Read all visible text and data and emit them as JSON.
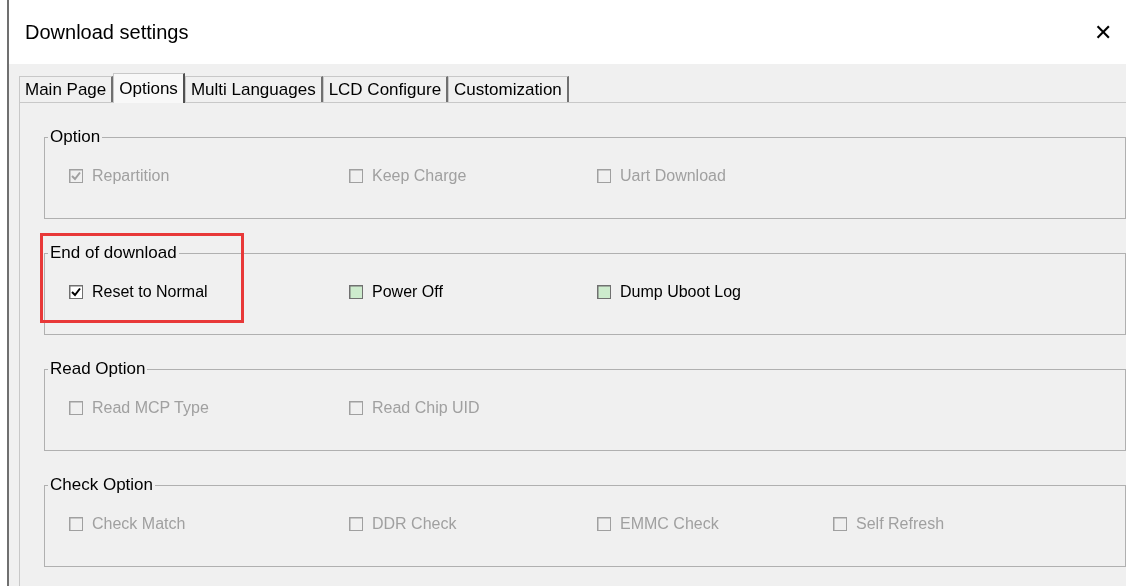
{
  "window": {
    "title": "Download settings",
    "close": "✕"
  },
  "tabs": [
    {
      "label": "Main Page",
      "selected": false
    },
    {
      "label": "Options",
      "selected": true
    },
    {
      "label": "Multi Languages",
      "selected": false
    },
    {
      "label": "LCD Configure",
      "selected": false
    },
    {
      "label": "Customization",
      "selected": false
    }
  ],
  "groups": [
    {
      "title": "Option",
      "highlighted": false,
      "items": [
        {
          "label": "Repartition",
          "checked": true,
          "disabled": true
        },
        {
          "label": "Keep Charge",
          "checked": false,
          "disabled": true
        },
        {
          "label": "Uart Download",
          "checked": false,
          "disabled": true
        }
      ]
    },
    {
      "title": "End of download",
      "highlighted": true,
      "items": [
        {
          "label": "Reset to Normal",
          "checked": true,
          "disabled": false
        },
        {
          "label": "Power Off",
          "checked": false,
          "disabled": false
        },
        {
          "label": "Dump Uboot Log",
          "checked": false,
          "disabled": false
        }
      ]
    },
    {
      "title": "Read Option",
      "highlighted": false,
      "items": [
        {
          "label": "Read MCP Type",
          "checked": false,
          "disabled": true
        },
        {
          "label": "Read Chip UID",
          "checked": false,
          "disabled": true
        }
      ]
    },
    {
      "title": "Check Option",
      "highlighted": false,
      "items": [
        {
          "label": "Check Match",
          "checked": false,
          "disabled": true
        },
        {
          "label": "DDR Check",
          "checked": false,
          "disabled": true
        },
        {
          "label": "EMMC Check",
          "checked": false,
          "disabled": true
        },
        {
          "label": "Self Refresh",
          "checked": false,
          "disabled": true
        }
      ]
    }
  ]
}
